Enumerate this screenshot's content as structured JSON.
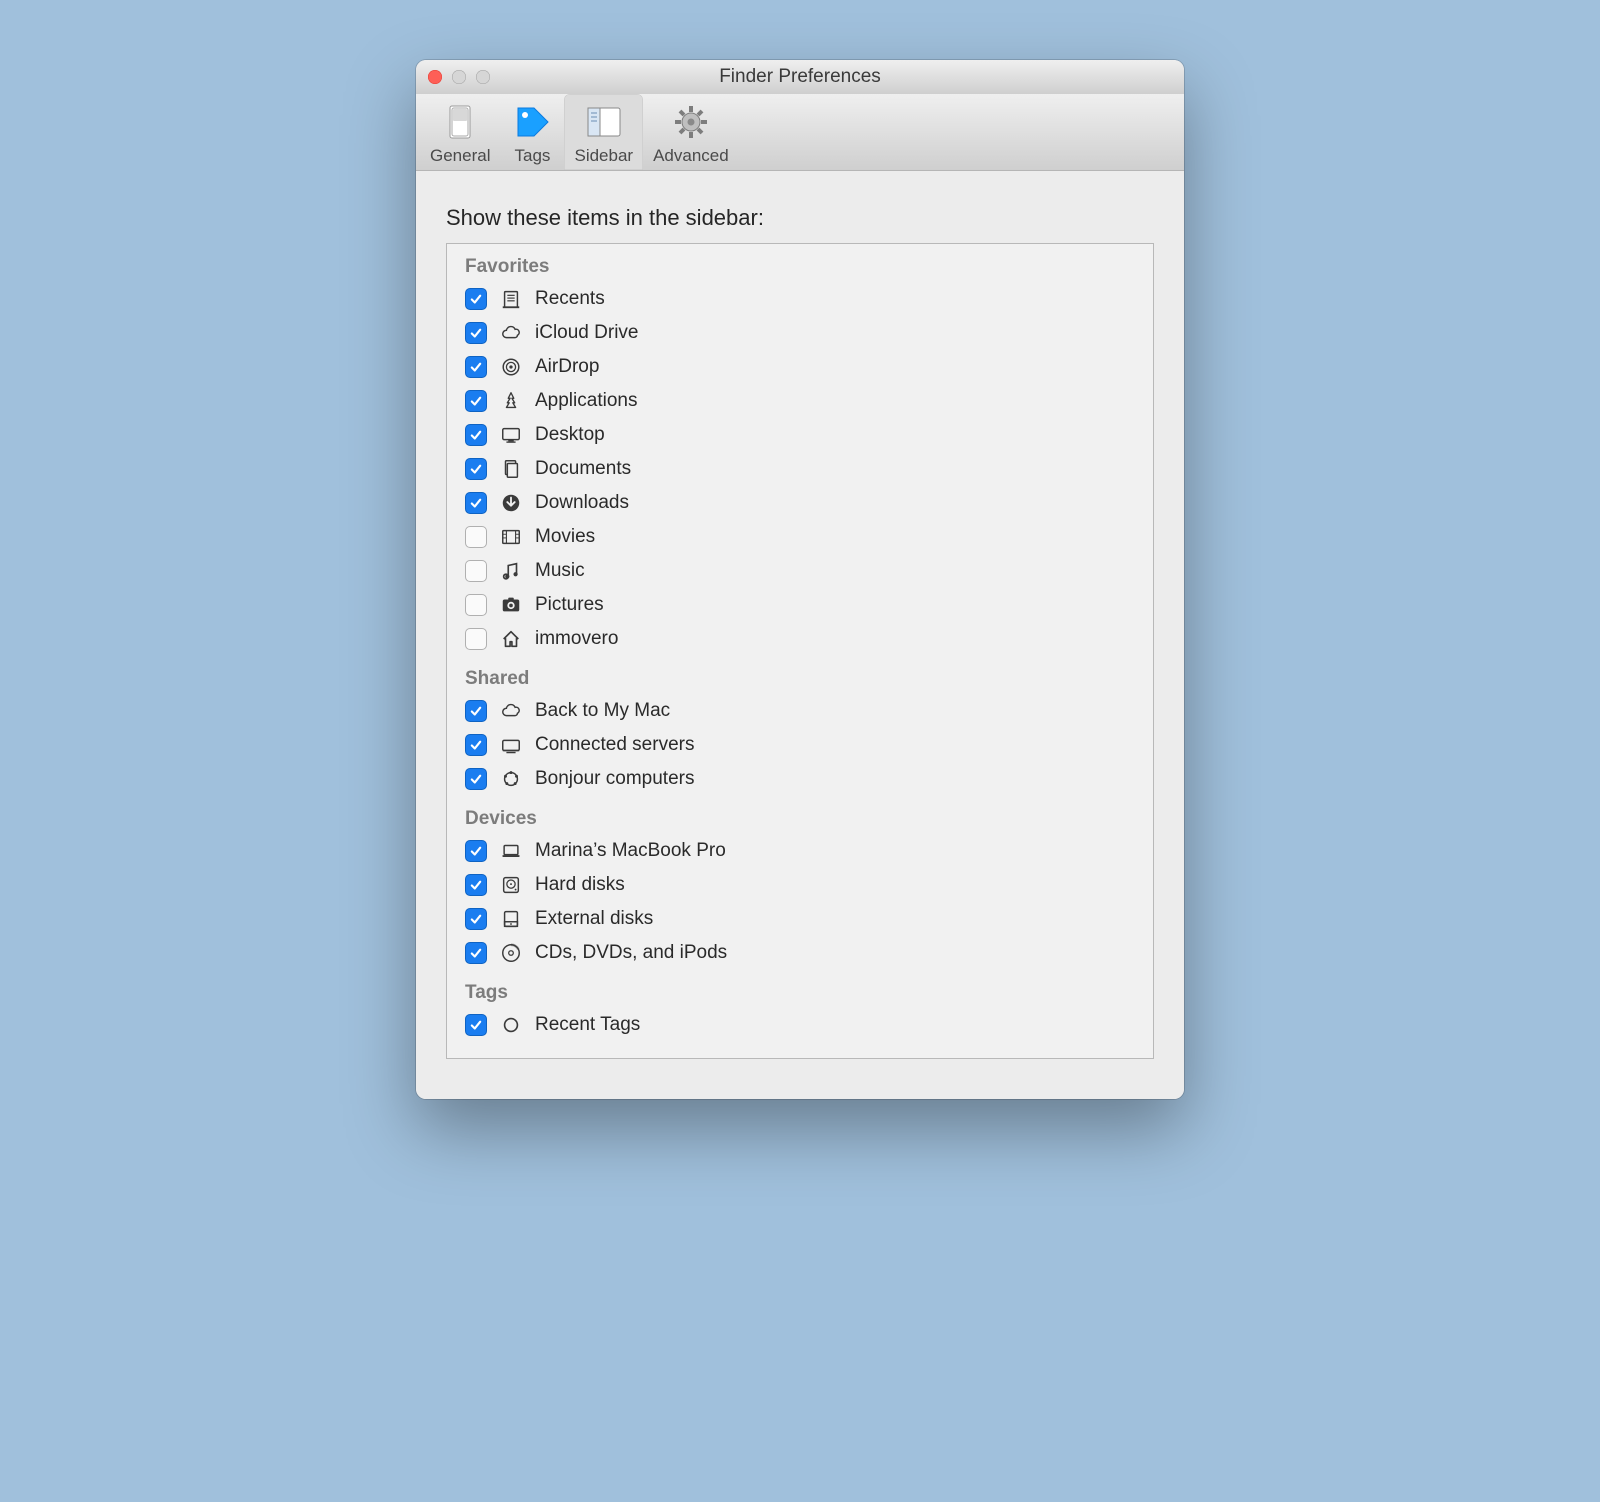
{
  "window": {
    "title": "Finder Preferences"
  },
  "toolbar": {
    "tabs": [
      {
        "label": "General",
        "icon": "switch-icon",
        "active": false
      },
      {
        "label": "Tags",
        "icon": "tag-icon",
        "active": false
      },
      {
        "label": "Sidebar",
        "icon": "sidebar-icon",
        "active": true
      },
      {
        "label": "Advanced",
        "icon": "gear-icon",
        "active": false
      }
    ]
  },
  "instruction": "Show these items in the sidebar:",
  "sections": [
    {
      "title": "Favorites",
      "items": [
        {
          "label": "Recents",
          "icon": "recents-icon",
          "checked": true
        },
        {
          "label": "iCloud Drive",
          "icon": "cloud-icon",
          "checked": true
        },
        {
          "label": "AirDrop",
          "icon": "airdrop-icon",
          "checked": true
        },
        {
          "label": "Applications",
          "icon": "applications-icon",
          "checked": true
        },
        {
          "label": "Desktop",
          "icon": "desktop-icon",
          "checked": true
        },
        {
          "label": "Documents",
          "icon": "documents-icon",
          "checked": true
        },
        {
          "label": "Downloads",
          "icon": "downloads-icon",
          "checked": true
        },
        {
          "label": "Movies",
          "icon": "movies-icon",
          "checked": false
        },
        {
          "label": "Music",
          "icon": "music-icon",
          "checked": false
        },
        {
          "label": "Pictures",
          "icon": "pictures-icon",
          "checked": false
        },
        {
          "label": "immovero",
          "icon": "home-icon",
          "checked": false
        }
      ]
    },
    {
      "title": "Shared",
      "items": [
        {
          "label": "Back to My Mac",
          "icon": "cloud-icon",
          "checked": true
        },
        {
          "label": "Connected servers",
          "icon": "server-icon",
          "checked": true
        },
        {
          "label": "Bonjour computers",
          "icon": "bonjour-icon",
          "checked": true
        }
      ]
    },
    {
      "title": "Devices",
      "items": [
        {
          "label": "Marina’s MacBook Pro",
          "icon": "laptop-icon",
          "checked": true
        },
        {
          "label": "Hard disks",
          "icon": "internal-disk-icon",
          "checked": true
        },
        {
          "label": "External disks",
          "icon": "external-disk-icon",
          "checked": true
        },
        {
          "label": "CDs, DVDs, and iPods",
          "icon": "disc-icon",
          "checked": true
        }
      ]
    },
    {
      "title": "Tags",
      "items": [
        {
          "label": "Recent Tags",
          "icon": "tag-circle-icon",
          "checked": true
        }
      ]
    }
  ]
}
